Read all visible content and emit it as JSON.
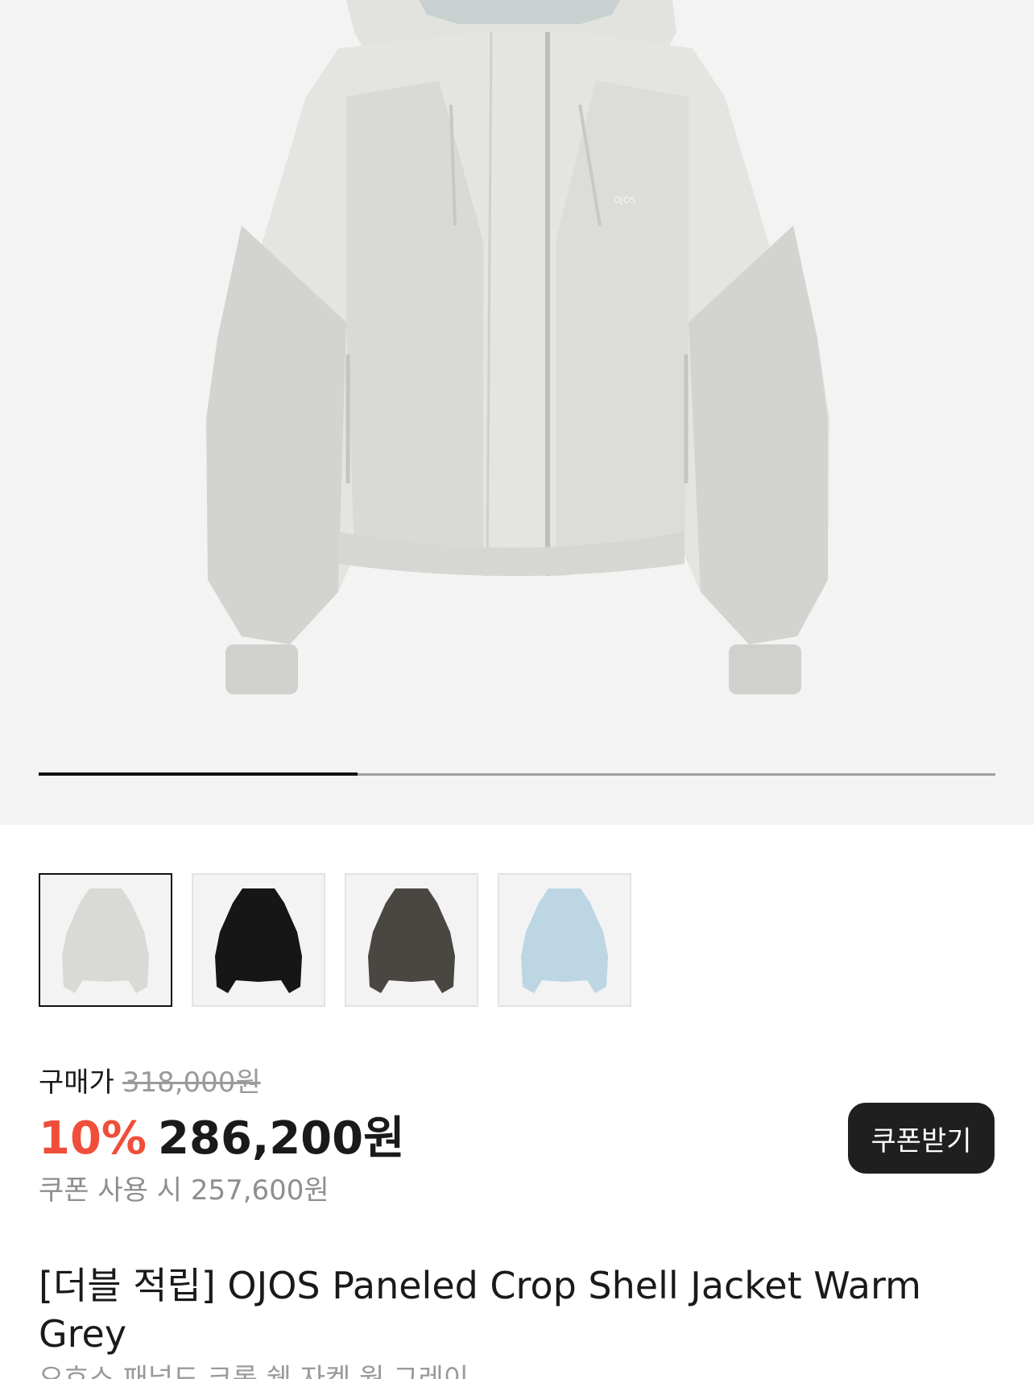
{
  "hero": {
    "image_alt": "OJOS Paneled Crop Shell Jacket Warm Grey",
    "logo_text": "OJOS",
    "carousel_progress": 0.333
  },
  "thumbnails": [
    {
      "color": "Warm Grey",
      "swatch": "#d9d9d5",
      "selected": true
    },
    {
      "color": "Black",
      "swatch": "#161616",
      "selected": false
    },
    {
      "color": "Charcoal",
      "swatch": "#4a4743",
      "selected": false
    },
    {
      "color": "Sky Blue",
      "swatch": "#bcd6e4",
      "selected": false
    }
  ],
  "price": {
    "label": "구매가",
    "original": "318,000원",
    "discount_rate": "10%",
    "sale_price": "286,200원",
    "coupon_note": "쿠폰 사용 시 257,600원",
    "coupon_button": "쿠폰받기"
  },
  "product": {
    "title": "[더블 적립] OJOS Paneled Crop Shell Jacket Warm Grey",
    "subtitle": "오호스 패널드 크롭 쉘 자켓 웜 그레이"
  },
  "colors": {
    "discount": "#f04e3a",
    "button_bg": "#1f1f1f",
    "hero_bg": "#f3f3f3"
  }
}
